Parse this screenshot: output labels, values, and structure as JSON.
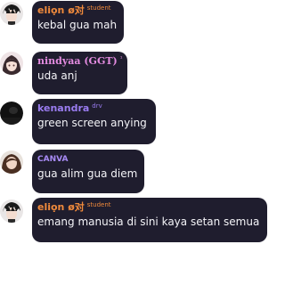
{
  "colors": {
    "bubble_bg": "#1f1d2e",
    "name_orange": "#f08a3c",
    "name_pink": "#e38be0",
    "name_purple": "#9a7cf0",
    "name_violet": "#a88bf5"
  },
  "messages": [
    {
      "name": "eliọn ø对",
      "tag": "student",
      "text": "kebal gua mah",
      "avatar_icon": "anime-boy-avatar-icon"
    },
    {
      "name": "nindyaa (GGT)",
      "tag": "¹",
      "text": "uda anj",
      "avatar_icon": "anime-girl-avatar-icon"
    },
    {
      "name": "kenandra",
      "tag": "drv",
      "text": "green screen anying",
      "avatar_icon": "dark-avatar-icon"
    },
    {
      "name": "CANVA",
      "tag": "",
      "text": "gua alim gua diem",
      "avatar_icon": "brown-hair-avatar-icon"
    },
    {
      "name": "eliọn ø对",
      "tag": "student",
      "text": "emang manusia di sini kaya setan semua",
      "avatar_icon": "anime-boy-avatar-icon"
    }
  ]
}
